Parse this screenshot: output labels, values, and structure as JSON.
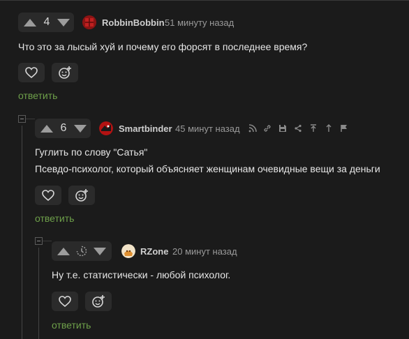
{
  "comments": [
    {
      "rating": "4",
      "author": "RobbinBobbin",
      "time": "51 минуту назад",
      "lines": [
        "Что это за лысый хуй и почему его форсят в последнее время?"
      ],
      "reply_label": "ответить"
    },
    {
      "rating": "6",
      "author": "Smartbinder",
      "time": "45 минут назад",
      "lines": [
        "Гуглить по слову \"Сатья\"",
        "Псевдо-психолог, который объясняет женщинам очевидные вещи за деньги"
      ],
      "reply_label": "ответить"
    },
    {
      "rating": "",
      "author": "RZone",
      "time": "20 минут назад",
      "lines": [
        "Ну т.е. статистически - любой психолог."
      ],
      "reply_label": "ответить"
    }
  ],
  "icons": {
    "vote_up": "arrow-up-icon",
    "vote_down": "arrow-down-icon",
    "rating_pending": "clock-icon",
    "like": "heart-icon",
    "reaction": "emoji-plus-icon",
    "collapse": "collapse-minus-icon",
    "tools": [
      "rss-icon",
      "link-icon",
      "save-icon",
      "share-icon",
      "to-top-icon",
      "to-parent-icon",
      "flag-icon"
    ]
  },
  "colors": {
    "background": "#1b1b1b",
    "reply_link": "#6ea04a",
    "pill": "#2a2a2a"
  }
}
